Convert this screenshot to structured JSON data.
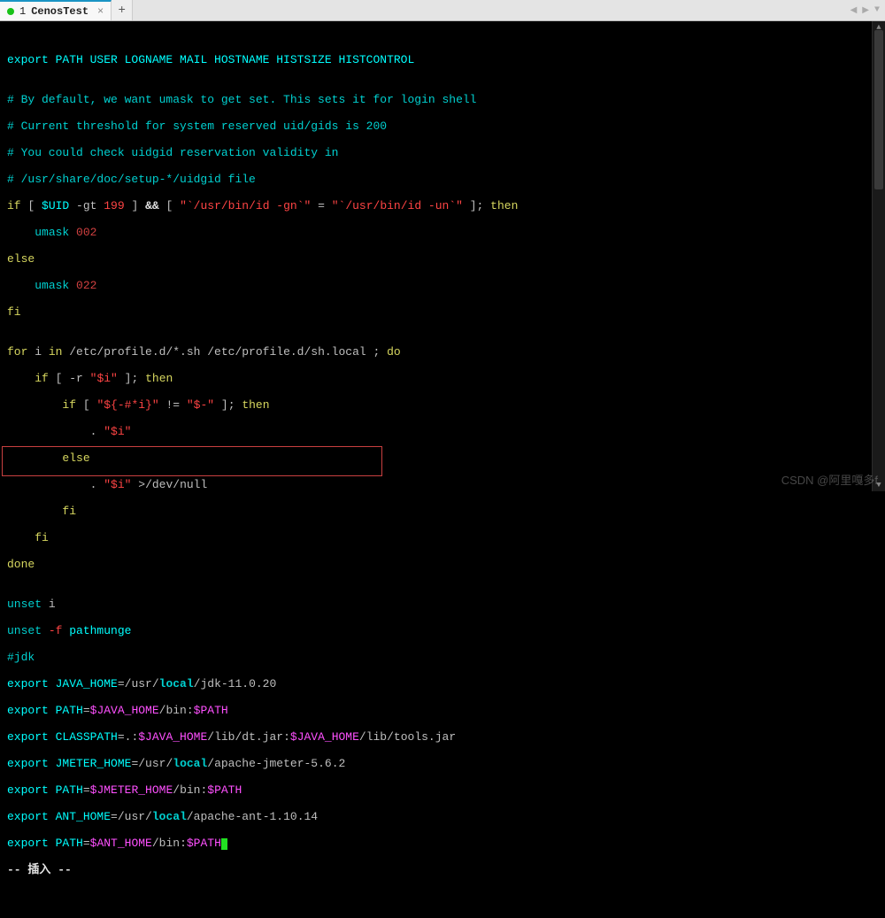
{
  "tab": {
    "index": "1",
    "title": "CenosTest",
    "close": "×",
    "new": "+"
  },
  "nav": {
    "left": "◀",
    "right": "▶",
    "menu": "▼"
  },
  "code": {
    "blank1": "",
    "l1_kw": "export",
    "l1_rest": " PATH USER LOGNAME MAIL HOSTNAME HISTSIZE HISTCONTROL",
    "blank2": "",
    "c1": "# By default, we want umask to get set. This sets it for login shell",
    "c2": "# Current threshold for system reserved uid/gids is 200",
    "c3": "# You could check uidgid reservation validity in",
    "c4": "# /usr/share/doc/setup-*/uidgid file",
    "if1_if": "if",
    "if1_b1": " [ ",
    "if1_uid": "$UID",
    "if1_gt": " -gt ",
    "if1_199": "199",
    "if1_b2": " ] ",
    "if1_andand": "&&",
    "if1_b3": " [ ",
    "if1_s1": "\"`/usr/bin/id -gn`\"",
    "if1_eq": " = ",
    "if1_s2": "\"`/usr/bin/id -un`\"",
    "if1_b4": " ]; ",
    "if1_then": "then",
    "um1_pad": "    ",
    "um1_kw": "umask",
    "um1_val": " 002",
    "else1": "else",
    "um2_pad": "    ",
    "um2_kw": "umask",
    "um2_val": " 022",
    "fi1": "fi",
    "blank3": "",
    "for_kw": "for",
    "for_i": " i ",
    "for_in": "in",
    "for_paths": " /etc/profile.d/*.sh /etc/profile.d/sh.local ; ",
    "for_do": "do",
    "if2_pad": "    ",
    "if2_if": "if",
    "if2_b1": " [ ",
    "if2_flag": "-r",
    "if2_sp": " ",
    "if2_arg": "\"$i\"",
    "if2_b2": " ]; ",
    "if2_then": "then",
    "if3_pad": "        ",
    "if3_if": "if",
    "if3_b1": " [ ",
    "if3_a1": "\"${-#*i}\"",
    "if3_ne": " != ",
    "if3_a2": "\"$-\"",
    "if3_b2": " ]; ",
    "if3_then": "then",
    "src1_pad": "            ",
    "src1_dot": ".",
    "src1_sp": " ",
    "src1_arg": "\"$i\"",
    "else2_pad": "        ",
    "else2": "else",
    "src2_pad": "            ",
    "src2_dot": ".",
    "src2_sp": " ",
    "src2_arg": "\"$i\"",
    "src2_redir": " >/dev/null",
    "fi3_pad": "        ",
    "fi3": "fi",
    "fi2_pad": "    ",
    "fi2": "fi",
    "done": "done",
    "blank4": "",
    "unset1_kw": "unset",
    "unset1_arg": " i",
    "unset2_kw": "unset",
    "unset2_flag": " -f",
    "unset2_arg": " pathmunge",
    "jdk": "#jdk",
    "e1_kw": "export",
    "e1_var": " JAVA_HOME",
    "e1_eq": "=",
    "e1_p1": "/usr/",
    "e1_local": "local",
    "e1_p2": "/jdk-11.0.20",
    "e2_kw": "export",
    "e2_var": " PATH",
    "e2_eq": "=",
    "e2_v1": "$JAVA_HOME",
    "e2_p1": "/bin:",
    "e2_v2": "$PATH",
    "e3_kw": "export",
    "e3_var": " CLASSPATH",
    "e3_eq": "=",
    "e3_p0": ".:",
    "e3_v1": "$JAVA_HOME",
    "e3_p1": "/lib/dt.jar:",
    "e3_v2": "$JAVA_HOME",
    "e3_p2": "/lib/tools.jar",
    "e4_kw": "export",
    "e4_var": " JMETER_HOME",
    "e4_eq": "=",
    "e4_p1": "/usr/",
    "e4_local": "local",
    "e4_p2": "/apache-jmeter-5.6.2",
    "e5_kw": "export",
    "e5_var": " PATH",
    "e5_eq": "=",
    "e5_v1": "$JMETER_HOME",
    "e5_p1": "/bin:",
    "e5_v2": "$PATH",
    "e6_kw": "export",
    "e6_var": " ANT_HOME",
    "e6_eq": "=",
    "e6_p1": "/usr/",
    "e6_local": "local",
    "e6_p2": "/apache-ant-1.10.14",
    "e7_kw": "export",
    "e7_var": " PATH",
    "e7_eq": "=",
    "e7_v1": "$ANT_HOME",
    "e7_p1": "/bin:",
    "e7_v2": "$PATH"
  },
  "status": "-- 插入 --",
  "watermark": "CSDN @阿里嘎多f"
}
